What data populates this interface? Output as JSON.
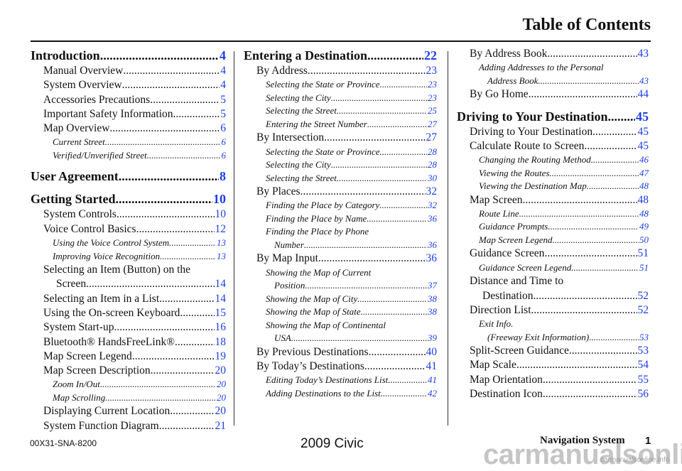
{
  "header": {
    "title": "Table of Contents"
  },
  "colors": {
    "page_link": "#1a3ee8",
    "text": "#111111"
  },
  "columns": [
    [
      {
        "level": 0,
        "label": "Introduction",
        "page": "4"
      },
      {
        "level": 1,
        "label": "Manual Overview",
        "page": "4"
      },
      {
        "level": 1,
        "label": "System Overview",
        "page": "4"
      },
      {
        "level": 1,
        "label": "Accessories Precautions",
        "page": "5"
      },
      {
        "level": 1,
        "label": "Important Safety Information",
        "page": "5"
      },
      {
        "level": 1,
        "label": "Map Overview",
        "page": "6"
      },
      {
        "level": 2,
        "label": "Current Street",
        "page": "6"
      },
      {
        "level": 2,
        "label": "Verified/Unverified Street",
        "page": "6"
      },
      {
        "level": 0,
        "label": "User Agreement",
        "page": "8"
      },
      {
        "level": 0,
        "label": "Getting Started",
        "page": "10"
      },
      {
        "level": 1,
        "label": "System Controls",
        "page": "10"
      },
      {
        "level": 1,
        "label": "Voice Control Basics",
        "page": "12"
      },
      {
        "level": 2,
        "label": "Using the Voice Control System",
        "page": "13"
      },
      {
        "level": 2,
        "label": "Improving Voice Recognition",
        "page": "13"
      },
      {
        "level": 1,
        "label": "Selecting an Item (Button) on the",
        "continuation": "Screen",
        "page": "14"
      },
      {
        "level": 1,
        "label": "Selecting an Item in a List",
        "page": "14"
      },
      {
        "level": 1,
        "label": "Using the On-screen Keyboard",
        "page": "15"
      },
      {
        "level": 1,
        "label": "System Start-up",
        "page": "16"
      },
      {
        "level": 1,
        "label": "Bluetooth® HandsFreeLink®",
        "page": "18"
      },
      {
        "level": 1,
        "label": "Map Screen Legend",
        "page": "19"
      },
      {
        "level": 1,
        "label": "Map Screen Description",
        "page": "20"
      },
      {
        "level": 2,
        "label": "Zoom In/Out",
        "page": "20"
      },
      {
        "level": 2,
        "label": "Map Scrolling",
        "page": "20"
      },
      {
        "level": 1,
        "label": "Displaying Current Location",
        "page": "20"
      },
      {
        "level": 1,
        "label": "System Function Diagram",
        "page": "21"
      }
    ],
    [
      {
        "level": 0,
        "label": "Entering a Destination",
        "page": "22"
      },
      {
        "level": 1,
        "label": "By Address",
        "page": "23"
      },
      {
        "level": 2,
        "label": "Selecting the State or Province",
        "page": "23"
      },
      {
        "level": 2,
        "label": "Selecting the City",
        "page": "23"
      },
      {
        "level": 2,
        "label": "Selecting the Street",
        "page": "25"
      },
      {
        "level": 2,
        "label": "Entering the Street Number",
        "page": "27"
      },
      {
        "level": 1,
        "label": "By Intersection",
        "page": "27"
      },
      {
        "level": 2,
        "label": "Selecting the State or Province",
        "page": "28"
      },
      {
        "level": 2,
        "label": "Selecting the City",
        "page": "28"
      },
      {
        "level": 2,
        "label": "Selecting the Street",
        "page": "30"
      },
      {
        "level": 1,
        "label": "By Places",
        "page": "32"
      },
      {
        "level": 2,
        "label": "Finding the Place by Category",
        "page": "32"
      },
      {
        "level": 2,
        "label": "Finding the Place by Name",
        "page": "36"
      },
      {
        "level": 2,
        "label": "Finding the Place by Phone",
        "continuation": "Number",
        "page": "36"
      },
      {
        "level": 1,
        "label": "By Map Input",
        "page": "36"
      },
      {
        "level": 2,
        "label": "Showing the Map of Current",
        "continuation": "Position",
        "page": "37"
      },
      {
        "level": 2,
        "label": "Showing the Map of City",
        "page": "38"
      },
      {
        "level": 2,
        "label": "Showing the Map of State",
        "page": "38"
      },
      {
        "level": 2,
        "label": "Showing the Map of Continental",
        "continuation": "USA",
        "page": "39"
      },
      {
        "level": 1,
        "label": "By Previous Destinations",
        "page": "40"
      },
      {
        "level": 1,
        "label": "By Today’s Destinations",
        "page": "41"
      },
      {
        "level": 2,
        "label": "Editing Today’s Destinations List",
        "page": "41"
      },
      {
        "level": 2,
        "label": "Adding Destinations to the List",
        "page": "42"
      }
    ],
    [
      {
        "level": 1,
        "label": "By Address Book",
        "page": "43"
      },
      {
        "level": 2,
        "label": "Adding Addresses to the Personal",
        "continuation": "Address Book",
        "page": "43"
      },
      {
        "level": 1,
        "label": "By Go Home",
        "page": "44"
      },
      {
        "level": 0,
        "label": "Driving to Your Destination",
        "page": "45"
      },
      {
        "level": 1,
        "label": "Driving to Your Destination",
        "page": "45"
      },
      {
        "level": 1,
        "label": "Calculate Route to Screen",
        "page": "45"
      },
      {
        "level": 2,
        "label": "Changing the Routing Method",
        "page": "46"
      },
      {
        "level": 2,
        "label": "Viewing the Routes",
        "page": "47"
      },
      {
        "level": 2,
        "label": "Viewing the Destination Map",
        "page": "48"
      },
      {
        "level": 1,
        "label": "Map Screen",
        "page": "48"
      },
      {
        "level": 2,
        "label": "Route Line",
        "page": "48"
      },
      {
        "level": 2,
        "label": "Guidance Prompts",
        "page": "49"
      },
      {
        "level": 2,
        "label": "Map Screen Legend",
        "page": "50"
      },
      {
        "level": 1,
        "label": "Guidance Screen",
        "page": "51"
      },
      {
        "level": 2,
        "label": "Guidance Screen Legend",
        "page": "51"
      },
      {
        "level": 1,
        "label": "Distance and Time to",
        "continuation": "Destination",
        "page": "52"
      },
      {
        "level": 1,
        "label": "Direction List",
        "page": "52"
      },
      {
        "level": 2,
        "label": "Exit Info.",
        "continuation": "(Freeway Exit Information)",
        "page": "53"
      },
      {
        "level": 1,
        "label": "Split-Screen Guidance",
        "page": "53"
      },
      {
        "level": 1,
        "label": "Map Scale",
        "page": "54"
      },
      {
        "level": 1,
        "label": "Map Orientation",
        "page": "55"
      },
      {
        "level": 1,
        "label": "Destination Icon",
        "page": "56"
      }
    ]
  ],
  "footer": {
    "code": "00X31-SNA-8200",
    "model": "2009  Civic",
    "section": "Navigation System",
    "page_number": "1",
    "watermark": "carmanualsonline.info",
    "watermark_small": "carmanualsonline.info"
  }
}
